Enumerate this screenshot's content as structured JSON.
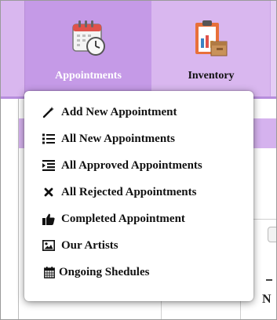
{
  "nav": {
    "items": [
      {
        "label": "Appointments",
        "icon": "calendar-clock-icon",
        "active": true
      },
      {
        "label": "Inventory",
        "icon": "inventory-clipboard-box-icon",
        "active": false
      }
    ],
    "active_bg": "#c59ae7",
    "bar_bg": "#d9b7ef"
  },
  "dropdown": {
    "items": [
      {
        "label": "Add New Appointment",
        "icon": "magic-wand-icon"
      },
      {
        "label": "All New Appointments",
        "icon": "list-icon"
      },
      {
        "label": "All Approved Appointments",
        "icon": "indent-list-icon"
      },
      {
        "label": "All Rejected Appointments",
        "icon": "times-icon"
      },
      {
        "label": "Completed Appointment",
        "icon": "thumbs-up-icon"
      },
      {
        "label": "Our Artists",
        "icon": "image-icon"
      },
      {
        "label": "Ongoing Shedules",
        "icon": "calendar-icon"
      }
    ]
  },
  "background": {
    "partial_text": "N"
  }
}
